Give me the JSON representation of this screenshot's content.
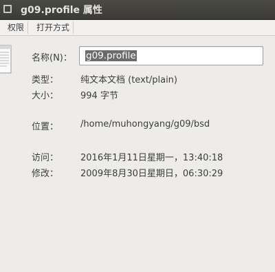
{
  "window": {
    "title": "g09.profile 属性"
  },
  "tabs": [
    {
      "label": "权限"
    },
    {
      "label": "打开方式"
    }
  ],
  "icons": {
    "window_button": "window-square-icon",
    "file": "text-document-icon"
  },
  "fields": {
    "name": {
      "label": "名称(N)：",
      "value": "g09.profile"
    },
    "type": {
      "label": "类型：",
      "value": "纯文本文档 (text/plain)"
    },
    "size": {
      "label": "大小：",
      "value": "994 字节"
    },
    "location": {
      "label": "位置：",
      "value": "/home/muhongyang/g09/bsd"
    },
    "accessed": {
      "label": "访问：",
      "value": "2016年1月11日星期一，13:40:18"
    },
    "modified": {
      "label": "修改：",
      "value": "2009年8月30日星期日，06:30:29"
    }
  },
  "colors": {
    "titlebar": "#3c3b37",
    "title_text": "#e4e3de",
    "background": "#edecea",
    "selection": "#6b6b6b"
  }
}
